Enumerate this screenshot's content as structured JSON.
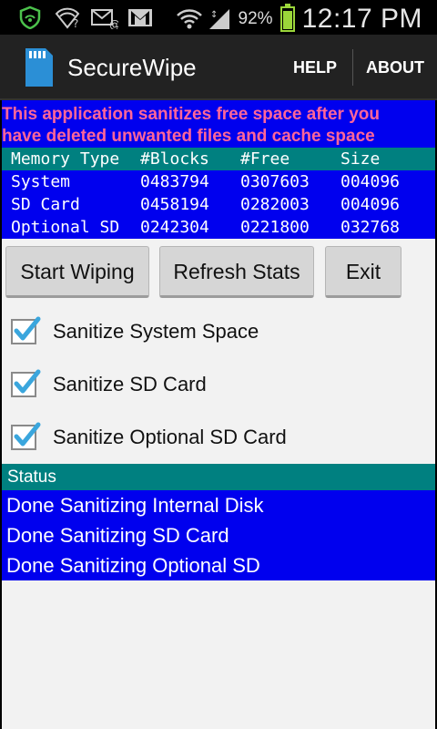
{
  "status_bar": {
    "battery_percent": "92%",
    "battery_level": 0.92,
    "time": "12:17 PM",
    "icons": [
      "shield-icon",
      "wifi-question-icon",
      "email-icon",
      "gmail-icon",
      "wifi-icon",
      "signal-icon"
    ]
  },
  "action_bar": {
    "title": "SecureWipe",
    "help_label": "HELP",
    "about_label": "ABOUT"
  },
  "intro_text": {
    "line1": "This application sanitizes free space after you",
    "line2": "have deleted unwanted files and cache space"
  },
  "memory_table": {
    "headers": [
      "Memory Type",
      "#Blocks",
      "#Free",
      "Size"
    ],
    "rows": [
      [
        "System",
        "0483794",
        "0307603",
        "004096"
      ],
      [
        "SD Card",
        "0458194",
        "0282003",
        "004096"
      ],
      [
        "Optional SD",
        "0242304",
        "0221800",
        "032768"
      ]
    ]
  },
  "buttons": {
    "start": "Start Wiping",
    "refresh": "Refresh Stats",
    "exit": "Exit"
  },
  "options": [
    {
      "label": "Sanitize System Space",
      "checked": true
    },
    {
      "label": "Sanitize SD Card",
      "checked": true
    },
    {
      "label": "Sanitize Optional SD Card",
      "checked": true
    }
  ],
  "status": {
    "header": "Status",
    "messages": [
      "Done Sanitizing Internal Disk",
      "Done Sanitizing SD Card",
      "Done Sanitizing Optional SD"
    ]
  },
  "colors": {
    "intro_bg": "#0000ee",
    "intro_text": "#ff6699",
    "table_header_bg": "#008080",
    "check_accent": "#3aa6dd"
  }
}
